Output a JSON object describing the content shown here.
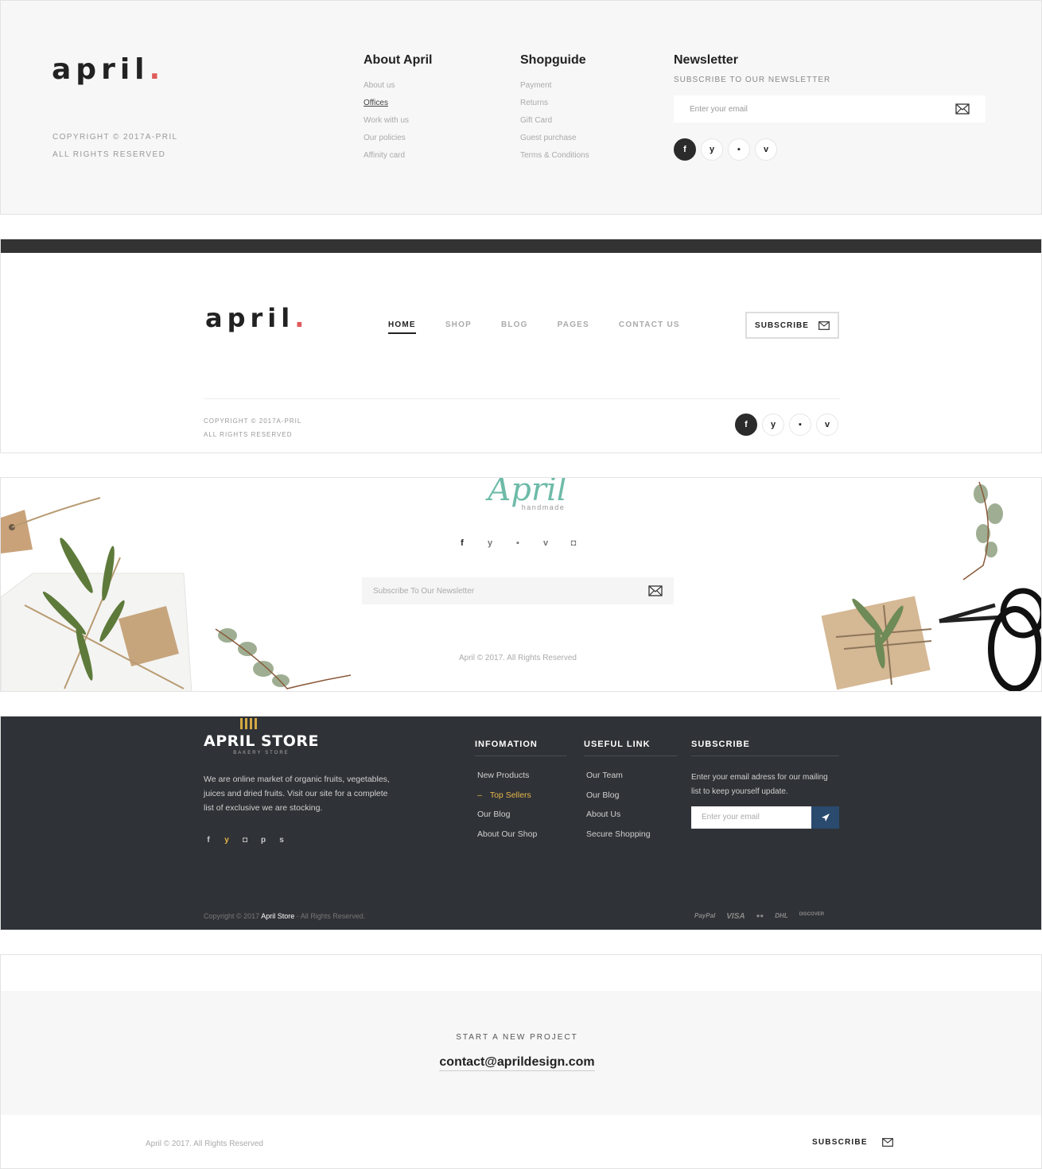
{
  "footer1": {
    "logo": "april",
    "copyright": "COPYRIGHT © 2017A-PRIL",
    "rights": "ALL RIGHTS RESERVED",
    "about": {
      "heading": "About April",
      "links": [
        "About us",
        "Offices",
        "Work with us",
        "Our policies",
        "Affinity card"
      ]
    },
    "shopguide": {
      "heading": "Shopguide",
      "links": [
        "Payment",
        "Returns",
        "Gift Card",
        "Guest purchase",
        "Terms & Conditions"
      ]
    },
    "newsletter": {
      "heading": "Newsletter",
      "sub": "SUBSCRIBE TO OUR NEWSLETTER",
      "placeholder": "Enter your email"
    },
    "social": [
      "f",
      "y",
      "▪",
      "v"
    ]
  },
  "footer2": {
    "logo": "april",
    "nav": [
      "HOME",
      "SHOP",
      "BLOG",
      "PAGES",
      "CONTACT US"
    ],
    "subscribe": "SUBSCRIBE",
    "copyright": "COPYRIGHT © 2017A-PRIL",
    "rights": "ALL RIGHTS RESERVED",
    "social": [
      "f",
      "y",
      "▪",
      "v"
    ]
  },
  "footer3": {
    "logo": "April",
    "logo_sub": "handmade",
    "social": [
      "f",
      "y",
      "▪",
      "v",
      "◘"
    ],
    "placeholder": "Subscribe To Our Newsletter",
    "copyright": "April © 2017. All Rights Reserved"
  },
  "footer4": {
    "logo": "APRIL STORE",
    "logo_sub": "BAKERY STORE",
    "desc": [
      "We are online market of organic fruits, vegetables,",
      "juices and dried fruits. Visit our site for a complete",
      "list of exclusive we are stocking."
    ],
    "social": [
      "f",
      "y",
      "◘",
      "p",
      "s"
    ],
    "info": {
      "heading": "INFOMATION",
      "links": [
        "New Products",
        "Top Sellers",
        "Our Blog",
        "About Our Shop"
      ]
    },
    "useful": {
      "heading": "USEFUL LINK",
      "links": [
        "Our Team",
        "Our Blog",
        "About Us",
        "Secure Shopping"
      ]
    },
    "subscribe": {
      "heading": "SUBSCRIBE",
      "text": [
        "Enter your email adress for our mailing",
        "list to keep yourself update."
      ],
      "placeholder": "Enter your email"
    },
    "copyright_pre": "Copyright © 2017",
    "copyright_brand": "April Store",
    "copyright_post": "- All Rights Reserved.",
    "payments": [
      "PayPal",
      "VISA",
      "●●",
      "DHL",
      "DISCOVER"
    ],
    "colors": {
      "bg": "#2f3236",
      "accent": "#e8b84a",
      "button": "#2a4a6e"
    }
  },
  "footer5": {
    "kicker": "START A NEW PROJECT",
    "email": "contact@aprildesign.com",
    "copyright": "April © 2017. All Rights Reserved",
    "subscribe": "SUBSCRIBE"
  }
}
